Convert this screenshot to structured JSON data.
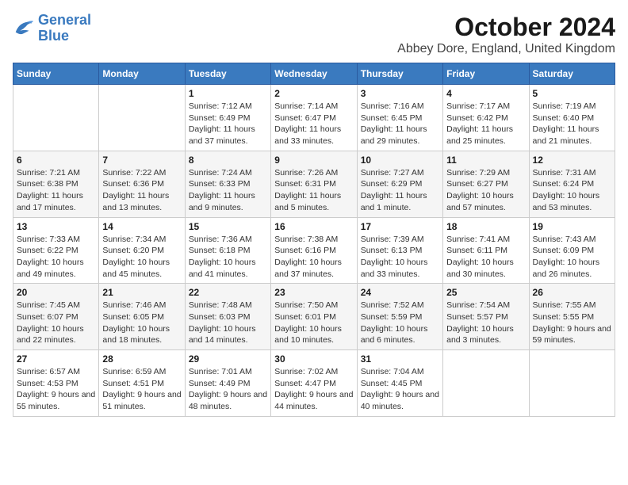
{
  "logo": {
    "line1": "General",
    "line2": "Blue"
  },
  "title": "October 2024",
  "subtitle": "Abbey Dore, England, United Kingdom",
  "days_of_week": [
    "Sunday",
    "Monday",
    "Tuesday",
    "Wednesday",
    "Thursday",
    "Friday",
    "Saturday"
  ],
  "weeks": [
    [
      {
        "day": "",
        "info": ""
      },
      {
        "day": "",
        "info": ""
      },
      {
        "day": "1",
        "info": "Sunrise: 7:12 AM\nSunset: 6:49 PM\nDaylight: 11 hours and 37 minutes."
      },
      {
        "day": "2",
        "info": "Sunrise: 7:14 AM\nSunset: 6:47 PM\nDaylight: 11 hours and 33 minutes."
      },
      {
        "day": "3",
        "info": "Sunrise: 7:16 AM\nSunset: 6:45 PM\nDaylight: 11 hours and 29 minutes."
      },
      {
        "day": "4",
        "info": "Sunrise: 7:17 AM\nSunset: 6:42 PM\nDaylight: 11 hours and 25 minutes."
      },
      {
        "day": "5",
        "info": "Sunrise: 7:19 AM\nSunset: 6:40 PM\nDaylight: 11 hours and 21 minutes."
      }
    ],
    [
      {
        "day": "6",
        "info": "Sunrise: 7:21 AM\nSunset: 6:38 PM\nDaylight: 11 hours and 17 minutes."
      },
      {
        "day": "7",
        "info": "Sunrise: 7:22 AM\nSunset: 6:36 PM\nDaylight: 11 hours and 13 minutes."
      },
      {
        "day": "8",
        "info": "Sunrise: 7:24 AM\nSunset: 6:33 PM\nDaylight: 11 hours and 9 minutes."
      },
      {
        "day": "9",
        "info": "Sunrise: 7:26 AM\nSunset: 6:31 PM\nDaylight: 11 hours and 5 minutes."
      },
      {
        "day": "10",
        "info": "Sunrise: 7:27 AM\nSunset: 6:29 PM\nDaylight: 11 hours and 1 minute."
      },
      {
        "day": "11",
        "info": "Sunrise: 7:29 AM\nSunset: 6:27 PM\nDaylight: 10 hours and 57 minutes."
      },
      {
        "day": "12",
        "info": "Sunrise: 7:31 AM\nSunset: 6:24 PM\nDaylight: 10 hours and 53 minutes."
      }
    ],
    [
      {
        "day": "13",
        "info": "Sunrise: 7:33 AM\nSunset: 6:22 PM\nDaylight: 10 hours and 49 minutes."
      },
      {
        "day": "14",
        "info": "Sunrise: 7:34 AM\nSunset: 6:20 PM\nDaylight: 10 hours and 45 minutes."
      },
      {
        "day": "15",
        "info": "Sunrise: 7:36 AM\nSunset: 6:18 PM\nDaylight: 10 hours and 41 minutes."
      },
      {
        "day": "16",
        "info": "Sunrise: 7:38 AM\nSunset: 6:16 PM\nDaylight: 10 hours and 37 minutes."
      },
      {
        "day": "17",
        "info": "Sunrise: 7:39 AM\nSunset: 6:13 PM\nDaylight: 10 hours and 33 minutes."
      },
      {
        "day": "18",
        "info": "Sunrise: 7:41 AM\nSunset: 6:11 PM\nDaylight: 10 hours and 30 minutes."
      },
      {
        "day": "19",
        "info": "Sunrise: 7:43 AM\nSunset: 6:09 PM\nDaylight: 10 hours and 26 minutes."
      }
    ],
    [
      {
        "day": "20",
        "info": "Sunrise: 7:45 AM\nSunset: 6:07 PM\nDaylight: 10 hours and 22 minutes."
      },
      {
        "day": "21",
        "info": "Sunrise: 7:46 AM\nSunset: 6:05 PM\nDaylight: 10 hours and 18 minutes."
      },
      {
        "day": "22",
        "info": "Sunrise: 7:48 AM\nSunset: 6:03 PM\nDaylight: 10 hours and 14 minutes."
      },
      {
        "day": "23",
        "info": "Sunrise: 7:50 AM\nSunset: 6:01 PM\nDaylight: 10 hours and 10 minutes."
      },
      {
        "day": "24",
        "info": "Sunrise: 7:52 AM\nSunset: 5:59 PM\nDaylight: 10 hours and 6 minutes."
      },
      {
        "day": "25",
        "info": "Sunrise: 7:54 AM\nSunset: 5:57 PM\nDaylight: 10 hours and 3 minutes."
      },
      {
        "day": "26",
        "info": "Sunrise: 7:55 AM\nSunset: 5:55 PM\nDaylight: 9 hours and 59 minutes."
      }
    ],
    [
      {
        "day": "27",
        "info": "Sunrise: 6:57 AM\nSunset: 4:53 PM\nDaylight: 9 hours and 55 minutes."
      },
      {
        "day": "28",
        "info": "Sunrise: 6:59 AM\nSunset: 4:51 PM\nDaylight: 9 hours and 51 minutes."
      },
      {
        "day": "29",
        "info": "Sunrise: 7:01 AM\nSunset: 4:49 PM\nDaylight: 9 hours and 48 minutes."
      },
      {
        "day": "30",
        "info": "Sunrise: 7:02 AM\nSunset: 4:47 PM\nDaylight: 9 hours and 44 minutes."
      },
      {
        "day": "31",
        "info": "Sunrise: 7:04 AM\nSunset: 4:45 PM\nDaylight: 9 hours and 40 minutes."
      },
      {
        "day": "",
        "info": ""
      },
      {
        "day": "",
        "info": ""
      }
    ]
  ]
}
